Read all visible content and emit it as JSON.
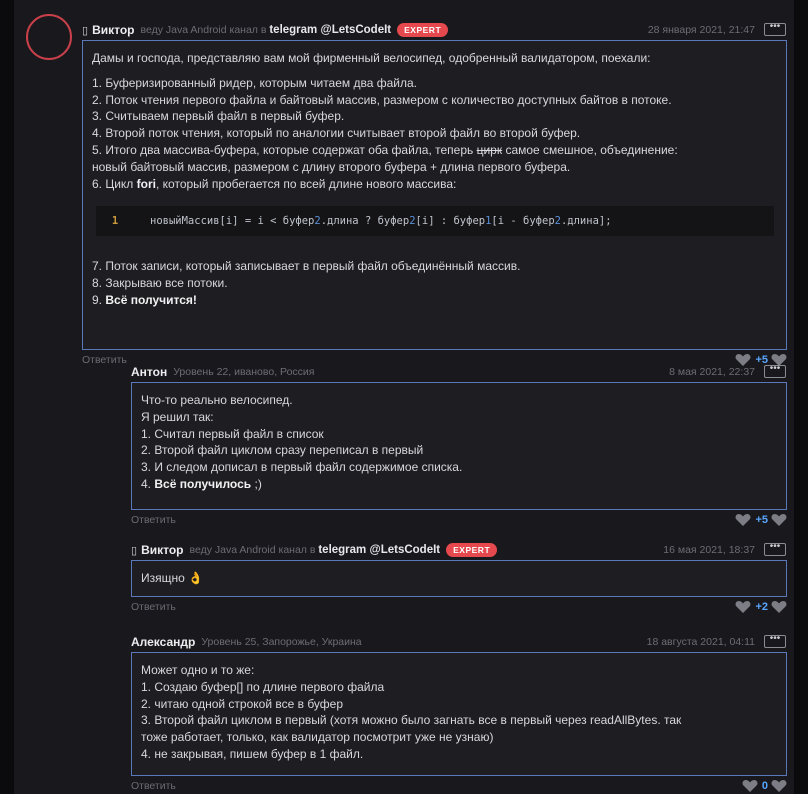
{
  "comments": [
    {
      "author": "Виктор",
      "meta": "веду Java Android канал в",
      "link": "telegram @LetsCodeIt",
      "badge": "EXPERT",
      "date": "28 января 2021, 21:47",
      "menu": "•••",
      "lines": {
        "intro": "Дамы и господа, представляю вам мой фирменный велосипед, одобренный валидатором, поехали:",
        "l1": "1. Буферизированный ридер, которым читаем два файла.",
        "l2": "2. Поток чтения первого файла и байтовый массив, размером с количество доступных байтов в потоке.",
        "l3": "3. Считываем первый файл в первый буфер.",
        "l4": "4. Второй поток чтения, который по аналогии считывает второй файл во второй буфер.",
        "l5a": "5. Итого два массива-буфера, которые содержат оба файла, теперь",
        "l5strike": "цирк",
        "l5b": "самое смешное, объединение:",
        "l5c": "новый байтовый массив, размером с длину второго буфера + длина первого буфера.",
        "l6a": "6. Цикл",
        "l6bold": "fori",
        "l6b": ", который пробегается по всей длине нового массива:",
        "l7": "7. Поток записи, который записывает в первый файл объединённый массив.",
        "l8": "8. Закрываю все потоки.",
        "l9a": "9.",
        "l9bold": "Всё получится!"
      },
      "code": {
        "line_no": "1",
        "p1": "новыйМассив[i] = i < буфер",
        "n1": "2",
        "p2": ".длина ? буфер",
        "n2": "2",
        "p3": "[i] : буфер",
        "n3": "1",
        "p4": "[i - буфер",
        "n4": "2",
        "p5": ".длина];"
      },
      "reply": "Ответить",
      "score": "+5"
    },
    {
      "author": "Антон",
      "meta": "Уровень 22, иваново, Россия",
      "date": "8 мая 2021, 22:37",
      "menu": "•••",
      "lines": {
        "l0": "Что-то реально велосипед.",
        "l1": "Я решил так:",
        "l2": "1. Считал первый файл в список",
        "l3": "2. Второй файл циклом сразу переписал в первый",
        "l4": "3. И следом дописал в первый файл содержимое списка.",
        "l5a": "4.",
        "l5bold": "Всё получилось",
        "l5b": " ;)"
      },
      "reply": "Ответить",
      "score": "+5"
    },
    {
      "author": "Виктор",
      "meta": "веду Java Android канал в",
      "link": "telegram @LetsCodeIt",
      "badge": "EXPERT",
      "date": "16 мая 2021, 18:37",
      "menu": "•••",
      "lines": {
        "l0": "Изящно 👌"
      },
      "reply": "Ответить",
      "score": "+2"
    },
    {
      "author": "Александр",
      "meta": "Уровень 25, Запорожье, Украина",
      "date": "18 августа 2021, 04:11",
      "menu": "•••",
      "lines": {
        "l0": "Может одно и то же:",
        "l1": "1. Создаю буфер[] по длине первого файла",
        "l2": "2. читаю одной строкой все в буфер",
        "l3": "3. Второй файл циклом в первый (хотя можно было  загнать все в первый через  readAllBytes. так",
        "l4": "тоже работает, только, как валидатор посмотрит уже не узнаю)",
        "l5": "4. не закрывая, пишем буфер в 1 файл."
      },
      "reply": "Ответить",
      "score": "0"
    }
  ]
}
